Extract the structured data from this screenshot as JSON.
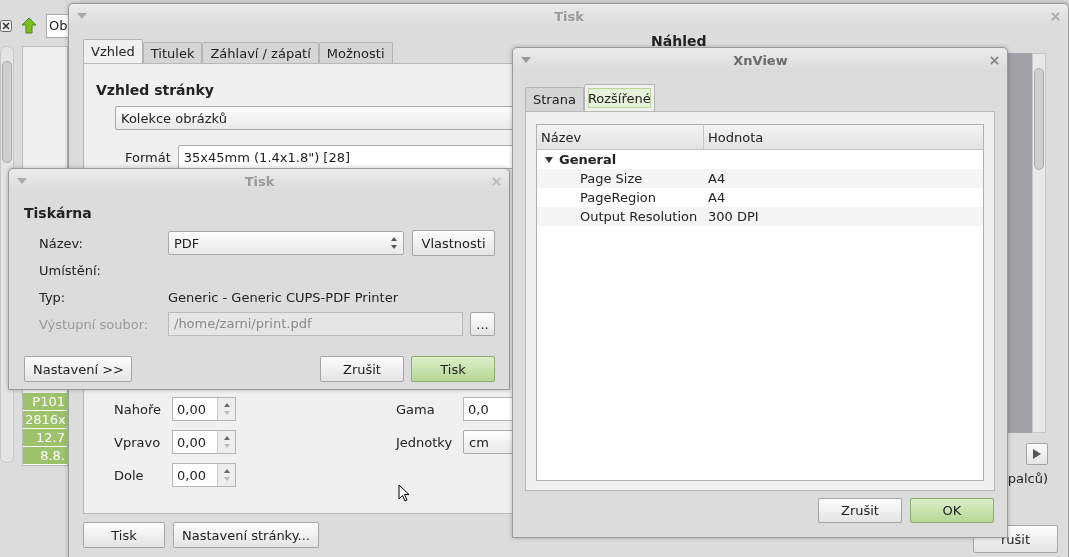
{
  "background_app": {
    "location_field": "Ob",
    "info_cells": [
      "P101",
      "2816x",
      "12.7",
      "8.8."
    ]
  },
  "print_window": {
    "title": "Tisk",
    "tabs": [
      {
        "label": "Vzhled",
        "selected": true
      },
      {
        "label": "Titulek",
        "selected": false
      },
      {
        "label": "Záhlaví / zápatí",
        "selected": false
      },
      {
        "label": "Možnosti",
        "selected": false
      }
    ],
    "section_heading": "Vzhled stránky",
    "layout_select": "Kolekce obrázků",
    "format_label": "Formát",
    "format_select": "35x45mm (1.4x1.8\") [28]",
    "margins": [
      {
        "label": "Nahoře",
        "value": "0,00"
      },
      {
        "label": "Vpravo",
        "value": "0,00"
      },
      {
        "label": "Dole",
        "value": "0,00"
      }
    ],
    "settings": [
      {
        "label": "Gama",
        "kind": "spinbox",
        "value": "0,0"
      },
      {
        "label": "Jednotky",
        "kind": "select",
        "value": "cm"
      }
    ],
    "preview_heading": "Náhled",
    "preview_caption": "palců)",
    "buttons": [
      "Tisk",
      "Nastavení stránky..."
    ],
    "cancel_button": "rušit"
  },
  "printer_dialog": {
    "title": "Tisk",
    "section_heading": "Tiskárna",
    "fields": [
      {
        "label": "Název:",
        "kind": "select",
        "value": "PDF",
        "button": "Vlastnosti",
        "disabled": false
      },
      {
        "label": "Umístění:",
        "kind": "text"
      },
      {
        "label": "Typ:",
        "kind": "text",
        "value": "Generic - Generic CUPS-PDF Printer"
      },
      {
        "label": "Výstupní soubor:",
        "kind": "file",
        "value": "/home/zarni/print.pdf",
        "button": "...",
        "disabled": true
      }
    ],
    "buttons": [
      {
        "label": "Nastavení >>",
        "default": false
      },
      {
        "label": "Zrušit",
        "default": false
      },
      {
        "label": "Tisk",
        "default": true
      }
    ]
  },
  "xnview_dialog": {
    "title": "XnView",
    "tabs": [
      {
        "label": "Strana",
        "selected": false
      },
      {
        "label": "Rozšířené",
        "selected": true
      }
    ],
    "columns": [
      "Název",
      "Hodnota"
    ],
    "groups": [
      {
        "label": "General",
        "expanded": true,
        "children": [
          {
            "name": "Page Size",
            "value": "A4"
          },
          {
            "name": "PageRegion",
            "value": "A4"
          },
          {
            "name": "Output Resolution",
            "value": "300 DPI"
          }
        ]
      }
    ],
    "buttons": [
      {
        "label": "Zrušit",
        "default": false
      },
      {
        "label": "OK",
        "default": true
      }
    ]
  }
}
